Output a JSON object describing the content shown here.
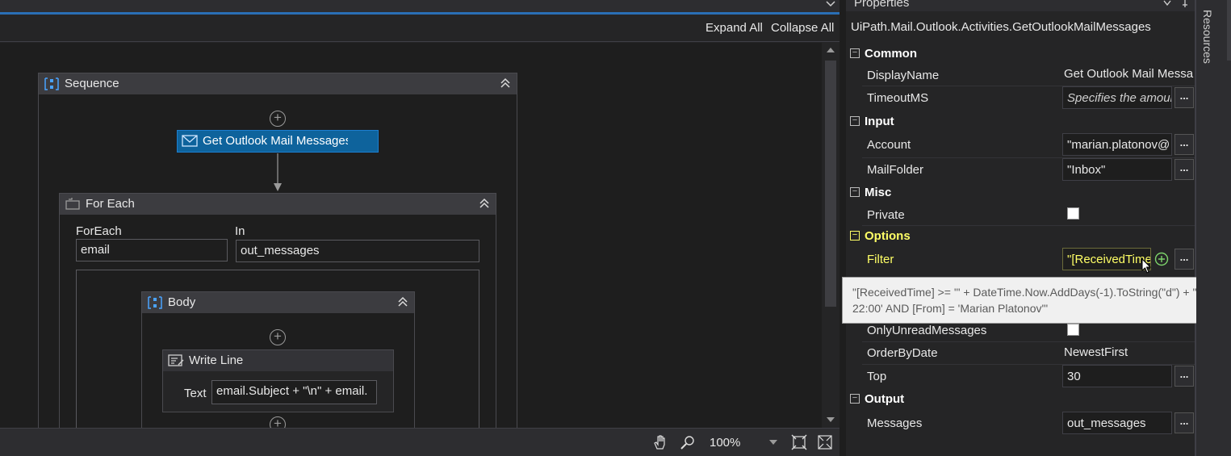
{
  "toolbar": {
    "expand_all": "Expand All",
    "collapse_all": "Collapse All"
  },
  "sequence": {
    "title": "Sequence",
    "get_outlook": "Get Outlook Mail Messages",
    "foreach": {
      "title": "For Each",
      "foreach_label": "ForEach",
      "foreach_value": "email",
      "in_label": "In",
      "in_value": "out_messages",
      "body": {
        "title": "Body",
        "writeline": {
          "title": "Write Line",
          "text_label": "Text",
          "text_value": "email.Subject + \"\\n\" + email."
        }
      }
    }
  },
  "status": {
    "zoom": "100%"
  },
  "properties": {
    "title": "Properties",
    "type": "UiPath.Mail.Outlook.Activities.GetOutlookMailMessages",
    "common": {
      "label": "Common",
      "display_name_label": "DisplayName",
      "display_name_value": "Get Outlook Mail Messa",
      "timeout_label": "TimeoutMS",
      "timeout_value": "Specifies the amoun"
    },
    "input": {
      "label": "Input",
      "account_label": "Account",
      "account_value": "\"marian.platonov@",
      "mailfolder_label": "MailFolder",
      "mailfolder_value": "\"Inbox\""
    },
    "misc": {
      "label": "Misc",
      "private_label": "Private"
    },
    "options": {
      "label": "Options",
      "filter_label": "Filter",
      "filter_value": "\"[ReceivedTime",
      "unread_label": "OnlyUnreadMessages",
      "order_label": "OrderByDate",
      "order_value": "NewestFirst",
      "top_label": "Top",
      "top_value": "30"
    },
    "output": {
      "label": "Output",
      "messages_label": "Messages",
      "messages_value": "out_messages"
    },
    "tooltip": "\"[ReceivedTime] >= '\" + DateTime.Now.AddDays(-1).ToString(\"d\") + \" 22:00' AND [From] = 'Marian Platonov'\""
  },
  "side": {
    "resources": "Resources"
  },
  "colors": {
    "accent": "#2a6fb5",
    "selected_activity": "#0e639c",
    "options_category": "#ffff66"
  }
}
